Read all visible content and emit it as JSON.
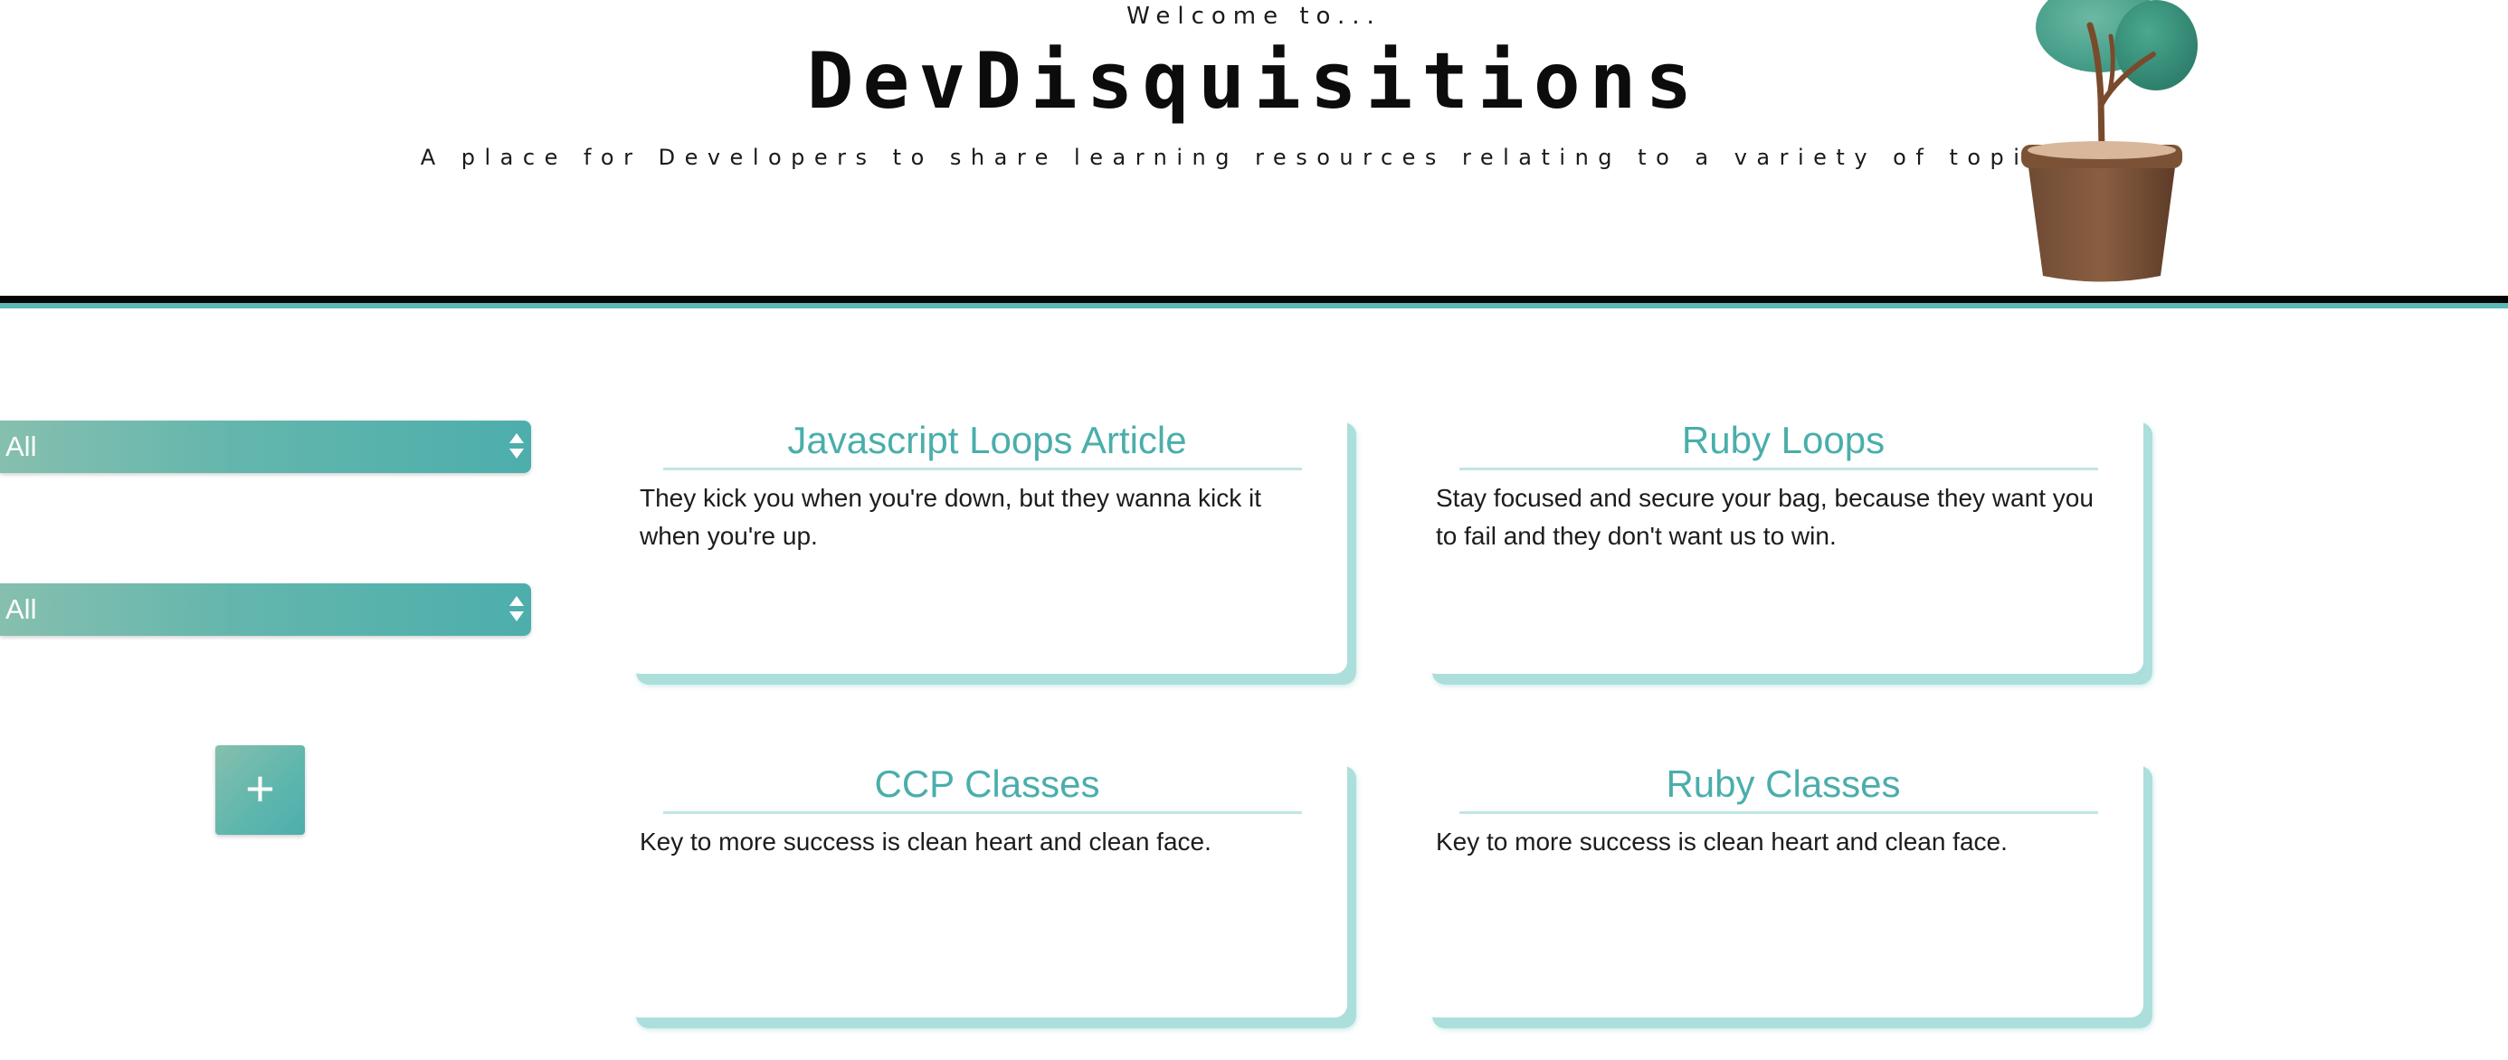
{
  "header": {
    "welcome": "Welcome to...",
    "site_title": "DevDisquisitions",
    "tagline": "A place for Developers to share learning resources relating to a variety of topics."
  },
  "sidebar": {
    "filters": [
      {
        "selected": "All"
      },
      {
        "selected": "All"
      }
    ],
    "add_label": "+"
  },
  "cards": [
    {
      "title": "Javascript Loops Article",
      "body": "They kick you when you're down, but they wanna kick it when you're up."
    },
    {
      "title": "Ruby Loops",
      "body": "Stay focused and secure your bag, because they want you to fail and they don't want us to win."
    },
    {
      "title": "CCP Classes",
      "body": "Key to more success is clean heart and clean face."
    },
    {
      "title": "Ruby Classes",
      "body": "Key to more success is clean heart and clean face."
    }
  ],
  "colors": {
    "accent": "#4aaeab",
    "accent_light": "#acdfdc",
    "divider_dark": "#050505",
    "divider_teal": "#5ab9b5"
  },
  "icons": {
    "logo": "potted-plant-icon",
    "select_arrows": "sort-arrows-icon",
    "add": "plus-icon"
  }
}
